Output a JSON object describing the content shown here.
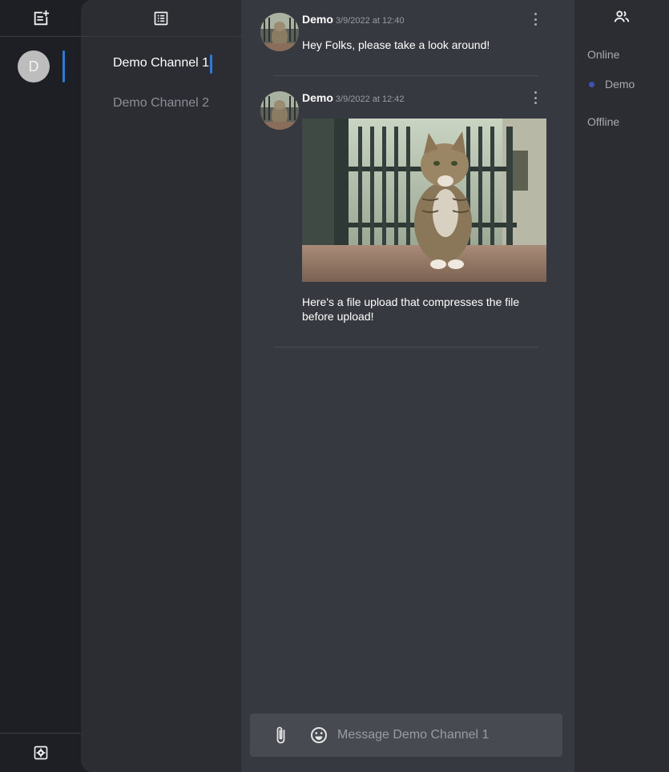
{
  "server_rail": {
    "top_icon": "note-add-icon",
    "server_initial": "D",
    "bottom_icon": "settings-icon"
  },
  "channels": {
    "header_icon": "list-icon",
    "items": [
      {
        "label": "Demo Channel 1",
        "active": true
      },
      {
        "label": "Demo Channel 2",
        "active": false
      }
    ]
  },
  "chat": {
    "messages": [
      {
        "author": "Demo",
        "timestamp": "3/9/2022 at 12:40",
        "text": "Hey Folks, please take a look around!",
        "has_image": false
      },
      {
        "author": "Demo",
        "timestamp": "3/9/2022 at 12:42",
        "text": "Here's a file upload that compresses the file before upload!",
        "has_image": true,
        "image_subject": "cat sitting by iron fence"
      }
    ],
    "composer": {
      "placeholder": "Message Demo Channel 1",
      "attach_icon": "paperclip-icon",
      "emoji_icon": "emoji-icon"
    }
  },
  "members": {
    "header_icon": "people-icon",
    "online_label": "Online",
    "offline_label": "Offline",
    "online": [
      {
        "name": "Demo",
        "status_color": "#3f51b5"
      }
    ]
  },
  "colors": {
    "accent": "#2a7ad6",
    "rail_bg": "#1e1f24",
    "panel_bg": "#2b2d33",
    "chat_bg": "#373940",
    "composer_bg": "#484a52"
  }
}
